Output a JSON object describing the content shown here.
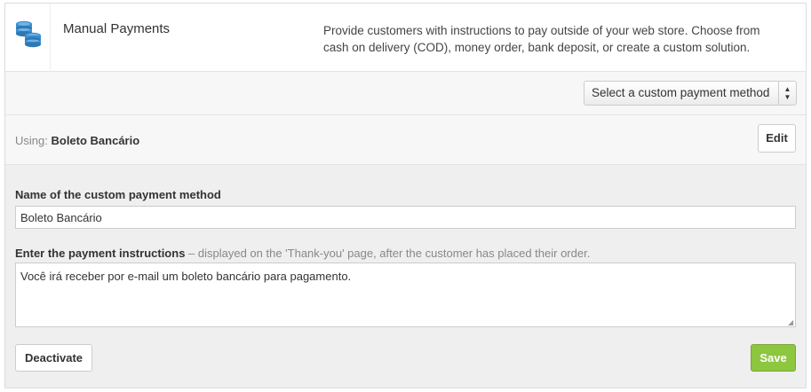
{
  "header": {
    "icon": "coins-stack-icon",
    "title": "Manual Payments",
    "description": "Provide customers with instructions to pay outside of your web store. Choose from cash on delivery (COD), money order, bank deposit, or create a custom solution."
  },
  "select": {
    "value": "Select a custom payment method"
  },
  "using": {
    "label": "Using:",
    "method": "Boleto Bancário",
    "edit_label": "Edit"
  },
  "form": {
    "name_label": "Name of the custom payment method",
    "name_value": "Boleto Bancário",
    "instructions_label": "Enter the payment instructions",
    "instructions_hint": " – displayed on the 'Thank-you' page, after the customer has placed their order.",
    "instructions_value": "Você irá receber por e-mail um boleto bancário para pagamento.",
    "deactivate_label": "Deactivate",
    "save_label": "Save"
  },
  "colors": {
    "accent_blue": "#3a8fd0",
    "save_green": "#8dc63f"
  }
}
